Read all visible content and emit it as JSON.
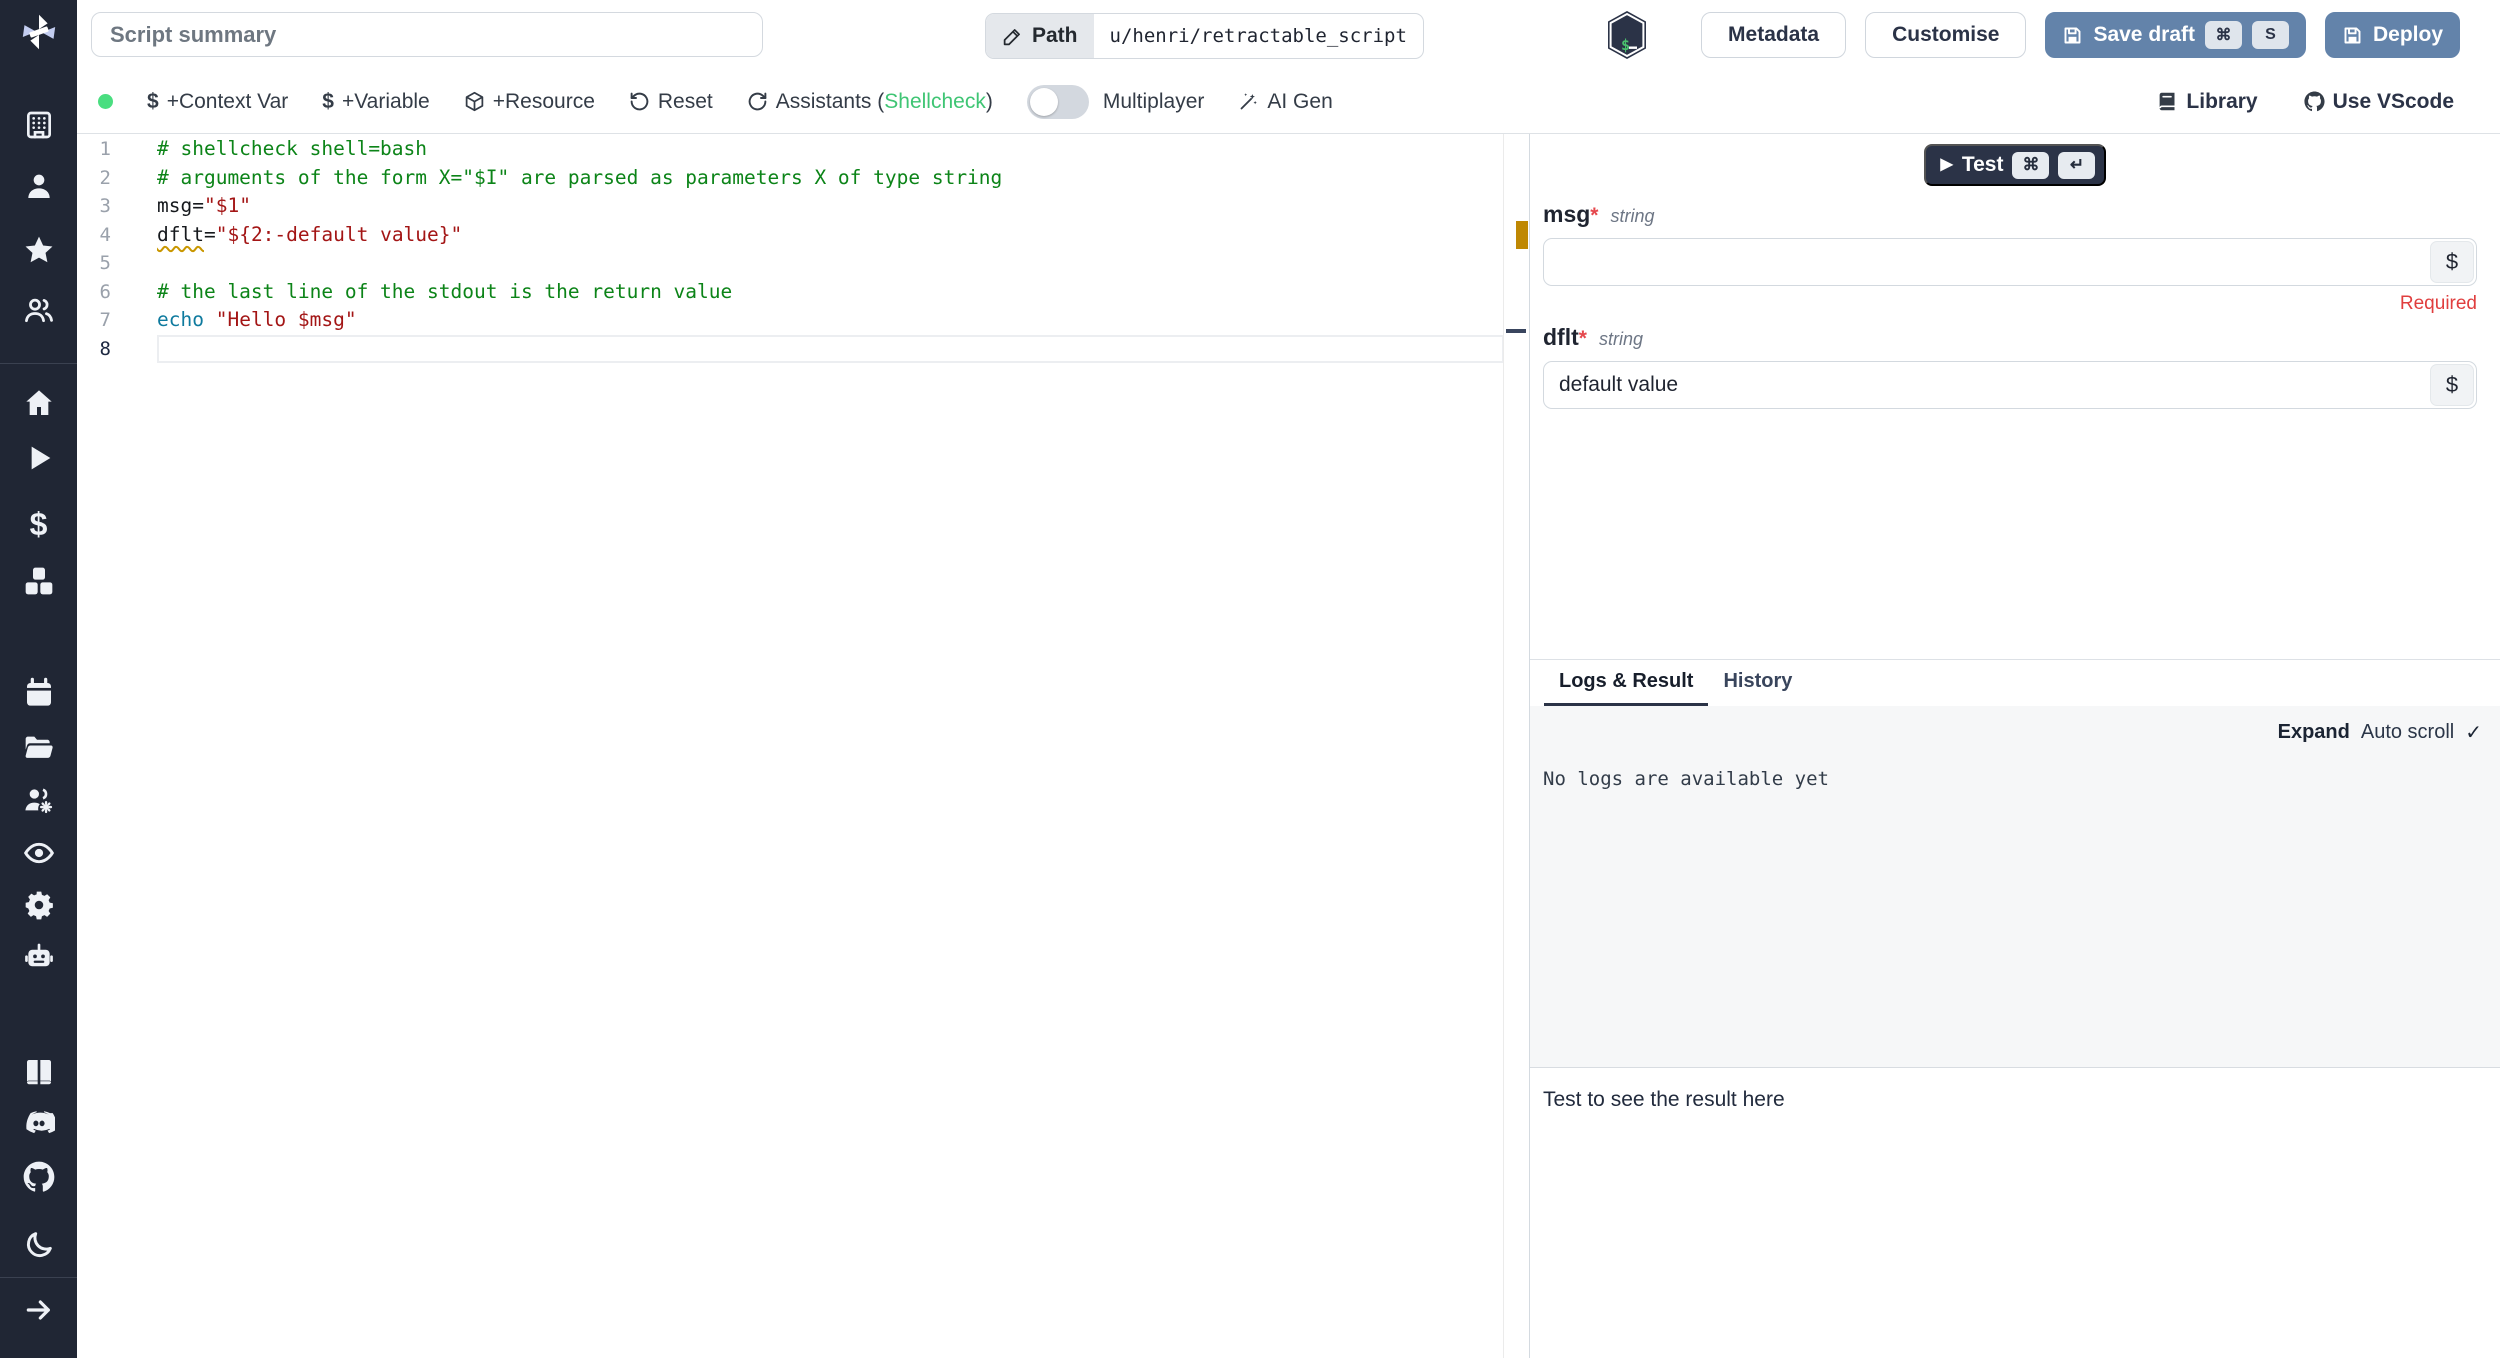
{
  "topbar": {
    "summary_placeholder": "Script summary",
    "path_label": "Path",
    "path_value": "u/henri/retractable_script",
    "metadata_label": "Metadata",
    "customise_label": "Customise",
    "save_draft_label": "Save draft",
    "save_draft_kbd": [
      "⌘",
      "S"
    ],
    "deploy_label": "Deploy"
  },
  "toolbar": {
    "dollar_glyph": "$",
    "context_var_label": "+Context Var",
    "variable_label": "+Variable",
    "resource_label": "+Resource",
    "reset_label": "Reset",
    "assistants_prefix": "Assistants (",
    "assistants_highlight": "Shellcheck",
    "assistants_suffix": ")",
    "multiplayer_label": "Multiplayer",
    "ai_gen_label": "AI Gen",
    "library_label": "Library",
    "vscode_label": "Use VScode",
    "status_color": "#4ade80",
    "shellcheck_color": "#3fc574"
  },
  "editor": {
    "language": "bash",
    "active_line": 8,
    "lines": [
      [
        {
          "text": "# shellcheck shell=bash",
          "type": "comment"
        }
      ],
      [
        {
          "text": "# arguments of the form X=\"$I\" are parsed as parameters X of type string",
          "type": "comment"
        }
      ],
      [
        {
          "text": "msg=",
          "type": "plain"
        },
        {
          "text": "\"$1\"",
          "type": "string"
        }
      ],
      [
        {
          "text": "dflt",
          "type": "plain warn"
        },
        {
          "text": "=",
          "type": "plain"
        },
        {
          "text": "\"${2:-default value}\"",
          "type": "string"
        }
      ],
      [],
      [
        {
          "text": "# the last line of the stdout is the return value",
          "type": "comment"
        }
      ],
      [
        {
          "text": "echo",
          "type": "builtin"
        },
        {
          "text": " ",
          "type": "plain"
        },
        {
          "text": "\"Hello $msg\"",
          "type": "string"
        }
      ],
      []
    ],
    "warning_marker_color": "#bf8803"
  },
  "runform": {
    "test_label": "Test",
    "test_play_glyph": "▶",
    "test_kbd": [
      "⌘",
      "↵"
    ],
    "dollar_button_label": "$",
    "fields": [
      {
        "name": "msg",
        "star": "*",
        "type": "string",
        "value": "",
        "required_note": "Required"
      },
      {
        "name": "dflt",
        "star": "*",
        "type": "string",
        "value": "default value"
      }
    ]
  },
  "tabs": {
    "logs_result_label": "Logs & Result",
    "history_label": "History"
  },
  "logs": {
    "expand_label": "Expand",
    "autoscroll_label": "Auto scroll",
    "check_glyph": "✓",
    "empty_message": "No logs are available yet"
  },
  "result": {
    "placeholder": "Test to see the result here"
  },
  "sidebar": {
    "accent_bg": "#202634",
    "icons": [
      "windmill-logo",
      "building",
      "user",
      "star",
      "users",
      "home",
      "play",
      "dollar",
      "boxes",
      "calendar",
      "folder-open",
      "users-gear",
      "eye",
      "gear",
      "robot",
      "book",
      "discord",
      "github",
      "moon",
      "arrow-right"
    ]
  },
  "brand": {
    "button_blue": "#6383aa",
    "dark_navy": "#2b3347"
  }
}
